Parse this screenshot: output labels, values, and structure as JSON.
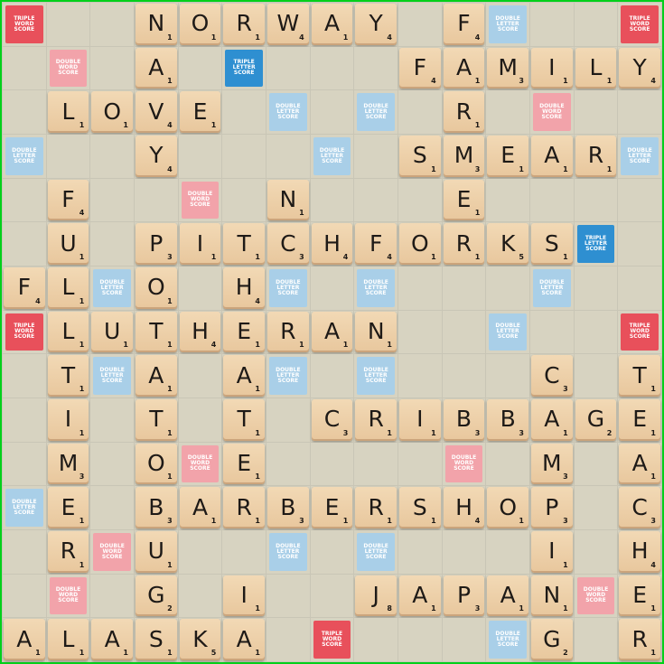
{
  "colors": {
    "frame": "#00d01a",
    "board": "#d7d3c1",
    "tile": "#ecd0a8",
    "TW": "#e8505b",
    "DW": "#f2a3aa",
    "TL": "#2e8fd1",
    "DL": "#a9cfe8"
  },
  "premium_labels": {
    "TW": "TRIPLE WORD SCORE",
    "DW": "DOUBLE WORD SCORE",
    "TL": "TRIPLE LETTER SCORE",
    "DL": "DOUBLE LETTER SCORE"
  },
  "premium_grid": [
    "TW...DL.......DL...TW",
    "...."
  ],
  "premium_cells": [
    {
      "r": 0,
      "c": 0,
      "type": "TW"
    },
    {
      "r": 0,
      "c": 11,
      "type": "DL"
    },
    {
      "r": 0,
      "c": 14,
      "type": "TW"
    },
    {
      "r": 1,
      "c": 1,
      "type": "DW"
    },
    {
      "r": 1,
      "c": 5,
      "type": "TL"
    },
    {
      "r": 2,
      "c": 6,
      "type": "DL"
    },
    {
      "r": 2,
      "c": 8,
      "type": "DL"
    },
    {
      "r": 2,
      "c": 12,
      "type": "DW"
    },
    {
      "r": 3,
      "c": 0,
      "type": "DL"
    },
    {
      "r": 3,
      "c": 7,
      "type": "DL"
    },
    {
      "r": 3,
      "c": 14,
      "type": "DL"
    },
    {
      "r": 4,
      "c": 4,
      "type": "DW"
    },
    {
      "r": 5,
      "c": 13,
      "type": "TL"
    },
    {
      "r": 6,
      "c": 2,
      "type": "DL"
    },
    {
      "r": 6,
      "c": 6,
      "type": "DL"
    },
    {
      "r": 6,
      "c": 8,
      "type": "DL"
    },
    {
      "r": 6,
      "c": 12,
      "type": "DL"
    },
    {
      "r": 7,
      "c": 0,
      "type": "TW"
    },
    {
      "r": 7,
      "c": 11,
      "type": "DL"
    },
    {
      "r": 7,
      "c": 14,
      "type": "TW"
    },
    {
      "r": 8,
      "c": 2,
      "type": "DL"
    },
    {
      "r": 8,
      "c": 6,
      "type": "DL"
    },
    {
      "r": 8,
      "c": 8,
      "type": "DL"
    },
    {
      "r": 10,
      "c": 4,
      "type": "DW"
    },
    {
      "r": 10,
      "c": 10,
      "type": "DW"
    },
    {
      "r": 11,
      "c": 0,
      "type": "DL"
    },
    {
      "r": 12,
      "c": 2,
      "type": "DW"
    },
    {
      "r": 12,
      "c": 6,
      "type": "DL"
    },
    {
      "r": 12,
      "c": 8,
      "type": "DL"
    },
    {
      "r": 13,
      "c": 1,
      "type": "DW"
    },
    {
      "r": 13,
      "c": 13,
      "type": "DW"
    },
    {
      "r": 14,
      "c": 7,
      "type": "TW"
    },
    {
      "r": 14,
      "c": 11,
      "type": "DL"
    }
  ],
  "tiles": [
    {
      "r": 0,
      "c": 3,
      "l": "N",
      "p": "1"
    },
    {
      "r": 0,
      "c": 4,
      "l": "O",
      "p": "1"
    },
    {
      "r": 0,
      "c": 5,
      "l": "R",
      "p": "1"
    },
    {
      "r": 0,
      "c": 6,
      "l": "W",
      "p": "4"
    },
    {
      "r": 0,
      "c": 7,
      "l": "A",
      "p": "1"
    },
    {
      "r": 0,
      "c": 8,
      "l": "Y",
      "p": "4"
    },
    {
      "r": 0,
      "c": 10,
      "l": "F",
      "p": "4"
    },
    {
      "r": 1,
      "c": 3,
      "l": "A",
      "p": "1"
    },
    {
      "r": 1,
      "c": 9,
      "l": "F",
      "p": "4"
    },
    {
      "r": 1,
      "c": 10,
      "l": "A",
      "p": "1"
    },
    {
      "r": 1,
      "c": 11,
      "l": "M",
      "p": "3"
    },
    {
      "r": 1,
      "c": 12,
      "l": "I",
      "p": "1"
    },
    {
      "r": 1,
      "c": 13,
      "l": "L",
      "p": "1"
    },
    {
      "r": 1,
      "c": 14,
      "l": "Y",
      "p": "4"
    },
    {
      "r": 2,
      "c": 1,
      "l": "L",
      "p": "1"
    },
    {
      "r": 2,
      "c": 2,
      "l": "O",
      "p": "1"
    },
    {
      "r": 2,
      "c": 3,
      "l": "V",
      "p": "4"
    },
    {
      "r": 2,
      "c": 4,
      "l": "E",
      "p": "1"
    },
    {
      "r": 2,
      "c": 10,
      "l": "R",
      "p": "1"
    },
    {
      "r": 3,
      "c": 3,
      "l": "Y",
      "p": "4"
    },
    {
      "r": 3,
      "c": 9,
      "l": "S",
      "p": "1"
    },
    {
      "r": 3,
      "c": 10,
      "l": "M",
      "p": "3"
    },
    {
      "r": 3,
      "c": 11,
      "l": "E",
      "p": "1"
    },
    {
      "r": 3,
      "c": 12,
      "l": "A",
      "p": "1"
    },
    {
      "r": 3,
      "c": 13,
      "l": "R",
      "p": "1"
    },
    {
      "r": 4,
      "c": 1,
      "l": "F",
      "p": "4"
    },
    {
      "r": 4,
      "c": 6,
      "l": "N",
      "p": "1"
    },
    {
      "r": 4,
      "c": 10,
      "l": "E",
      "p": "1"
    },
    {
      "r": 5,
      "c": 1,
      "l": "U",
      "p": "1"
    },
    {
      "r": 5,
      "c": 3,
      "l": "P",
      "p": "3"
    },
    {
      "r": 5,
      "c": 4,
      "l": "I",
      "p": "1"
    },
    {
      "r": 5,
      "c": 5,
      "l": "T",
      "p": "1"
    },
    {
      "r": 5,
      "c": 6,
      "l": "C",
      "p": "3"
    },
    {
      "r": 5,
      "c": 7,
      "l": "H",
      "p": "4"
    },
    {
      "r": 5,
      "c": 8,
      "l": "F",
      "p": "4"
    },
    {
      "r": 5,
      "c": 9,
      "l": "O",
      "p": "1"
    },
    {
      "r": 5,
      "c": 10,
      "l": "R",
      "p": "1"
    },
    {
      "r": 5,
      "c": 11,
      "l": "K",
      "p": "5"
    },
    {
      "r": 5,
      "c": 12,
      "l": "S",
      "p": "1"
    },
    {
      "r": 6,
      "c": 0,
      "l": "F",
      "p": "4"
    },
    {
      "r": 6,
      "c": 1,
      "l": "L",
      "p": "1"
    },
    {
      "r": 6,
      "c": 3,
      "l": "O",
      "p": "1"
    },
    {
      "r": 6,
      "c": 5,
      "l": "H",
      "p": "4"
    },
    {
      "r": 7,
      "c": 1,
      "l": "L",
      "p": "1"
    },
    {
      "r": 7,
      "c": 2,
      "l": "U",
      "p": "1"
    },
    {
      "r": 7,
      "c": 3,
      "l": "T",
      "p": "1"
    },
    {
      "r": 7,
      "c": 4,
      "l": "H",
      "p": "4"
    },
    {
      "r": 7,
      "c": 5,
      "l": "E",
      "p": "1"
    },
    {
      "r": 7,
      "c": 6,
      "l": "R",
      "p": "1"
    },
    {
      "r": 7,
      "c": 7,
      "l": "A",
      "p": "1"
    },
    {
      "r": 7,
      "c": 8,
      "l": "N",
      "p": "1"
    },
    {
      "r": 8,
      "c": 1,
      "l": "T",
      "p": "1"
    },
    {
      "r": 8,
      "c": 3,
      "l": "A",
      "p": "1"
    },
    {
      "r": 8,
      "c": 5,
      "l": "A",
      "p": "1"
    },
    {
      "r": 8,
      "c": 12,
      "l": "C",
      "p": "3"
    },
    {
      "r": 8,
      "c": 14,
      "l": "T",
      "p": "1"
    },
    {
      "r": 9,
      "c": 1,
      "l": "I",
      "p": "1"
    },
    {
      "r": 9,
      "c": 3,
      "l": "T",
      "p": "1"
    },
    {
      "r": 9,
      "c": 5,
      "l": "T",
      "p": "1"
    },
    {
      "r": 9,
      "c": 7,
      "l": "C",
      "p": "3"
    },
    {
      "r": 9,
      "c": 8,
      "l": "R",
      "p": "1"
    },
    {
      "r": 9,
      "c": 9,
      "l": "I",
      "p": "1"
    },
    {
      "r": 9,
      "c": 10,
      "l": "B",
      "p": "3"
    },
    {
      "r": 9,
      "c": 11,
      "l": "B",
      "p": "3"
    },
    {
      "r": 9,
      "c": 12,
      "l": "A",
      "p": "1"
    },
    {
      "r": 9,
      "c": 13,
      "l": "G",
      "p": "2"
    },
    {
      "r": 9,
      "c": 14,
      "l": "E",
      "p": "1"
    },
    {
      "r": 10,
      "c": 1,
      "l": "M",
      "p": "3"
    },
    {
      "r": 10,
      "c": 3,
      "l": "O",
      "p": "1"
    },
    {
      "r": 10,
      "c": 5,
      "l": "E",
      "p": "1"
    },
    {
      "r": 10,
      "c": 12,
      "l": "M",
      "p": "3"
    },
    {
      "r": 10,
      "c": 14,
      "l": "A",
      "p": "1"
    },
    {
      "r": 11,
      "c": 1,
      "l": "E",
      "p": "1"
    },
    {
      "r": 11,
      "c": 3,
      "l": "B",
      "p": "3"
    },
    {
      "r": 11,
      "c": 4,
      "l": "A",
      "p": "1"
    },
    {
      "r": 11,
      "c": 5,
      "l": "R",
      "p": "1"
    },
    {
      "r": 11,
      "c": 6,
      "l": "B",
      "p": "3"
    },
    {
      "r": 11,
      "c": 7,
      "l": "E",
      "p": "1"
    },
    {
      "r": 11,
      "c": 8,
      "l": "R",
      "p": "1"
    },
    {
      "r": 11,
      "c": 9,
      "l": "S",
      "p": "1"
    },
    {
      "r": 11,
      "c": 10,
      "l": "H",
      "p": "4"
    },
    {
      "r": 11,
      "c": 11,
      "l": "O",
      "p": "1"
    },
    {
      "r": 11,
      "c": 12,
      "l": "P",
      "p": "3"
    },
    {
      "r": 11,
      "c": 14,
      "l": "C",
      "p": "3"
    },
    {
      "r": 12,
      "c": 1,
      "l": "R",
      "p": "1"
    },
    {
      "r": 12,
      "c": 3,
      "l": "U",
      "p": "1"
    },
    {
      "r": 12,
      "c": 12,
      "l": "I",
      "p": "1"
    },
    {
      "r": 12,
      "c": 14,
      "l": "H",
      "p": "4"
    },
    {
      "r": 13,
      "c": 3,
      "l": "G",
      "p": "2"
    },
    {
      "r": 13,
      "c": 5,
      "l": "I",
      "p": "1"
    },
    {
      "r": 13,
      "c": 8,
      "l": "J",
      "p": "8"
    },
    {
      "r": 13,
      "c": 9,
      "l": "A",
      "p": "1"
    },
    {
      "r": 13,
      "c": 10,
      "l": "P",
      "p": "3"
    },
    {
      "r": 13,
      "c": 11,
      "l": "A",
      "p": "1"
    },
    {
      "r": 13,
      "c": 12,
      "l": "N",
      "p": "1"
    },
    {
      "r": 13,
      "c": 14,
      "l": "E",
      "p": "1"
    },
    {
      "r": 14,
      "c": 0,
      "l": "A",
      "p": "1"
    },
    {
      "r": 14,
      "c": 1,
      "l": "L",
      "p": "1"
    },
    {
      "r": 14,
      "c": 2,
      "l": "A",
      "p": "1"
    },
    {
      "r": 14,
      "c": 3,
      "l": "S",
      "p": "1"
    },
    {
      "r": 14,
      "c": 4,
      "l": "K",
      "p": "5"
    },
    {
      "r": 14,
      "c": 5,
      "l": "A",
      "p": "1"
    },
    {
      "r": 14,
      "c": 12,
      "l": "G",
      "p": "2"
    },
    {
      "r": 14,
      "c": 14,
      "l": "R",
      "p": "1"
    }
  ]
}
